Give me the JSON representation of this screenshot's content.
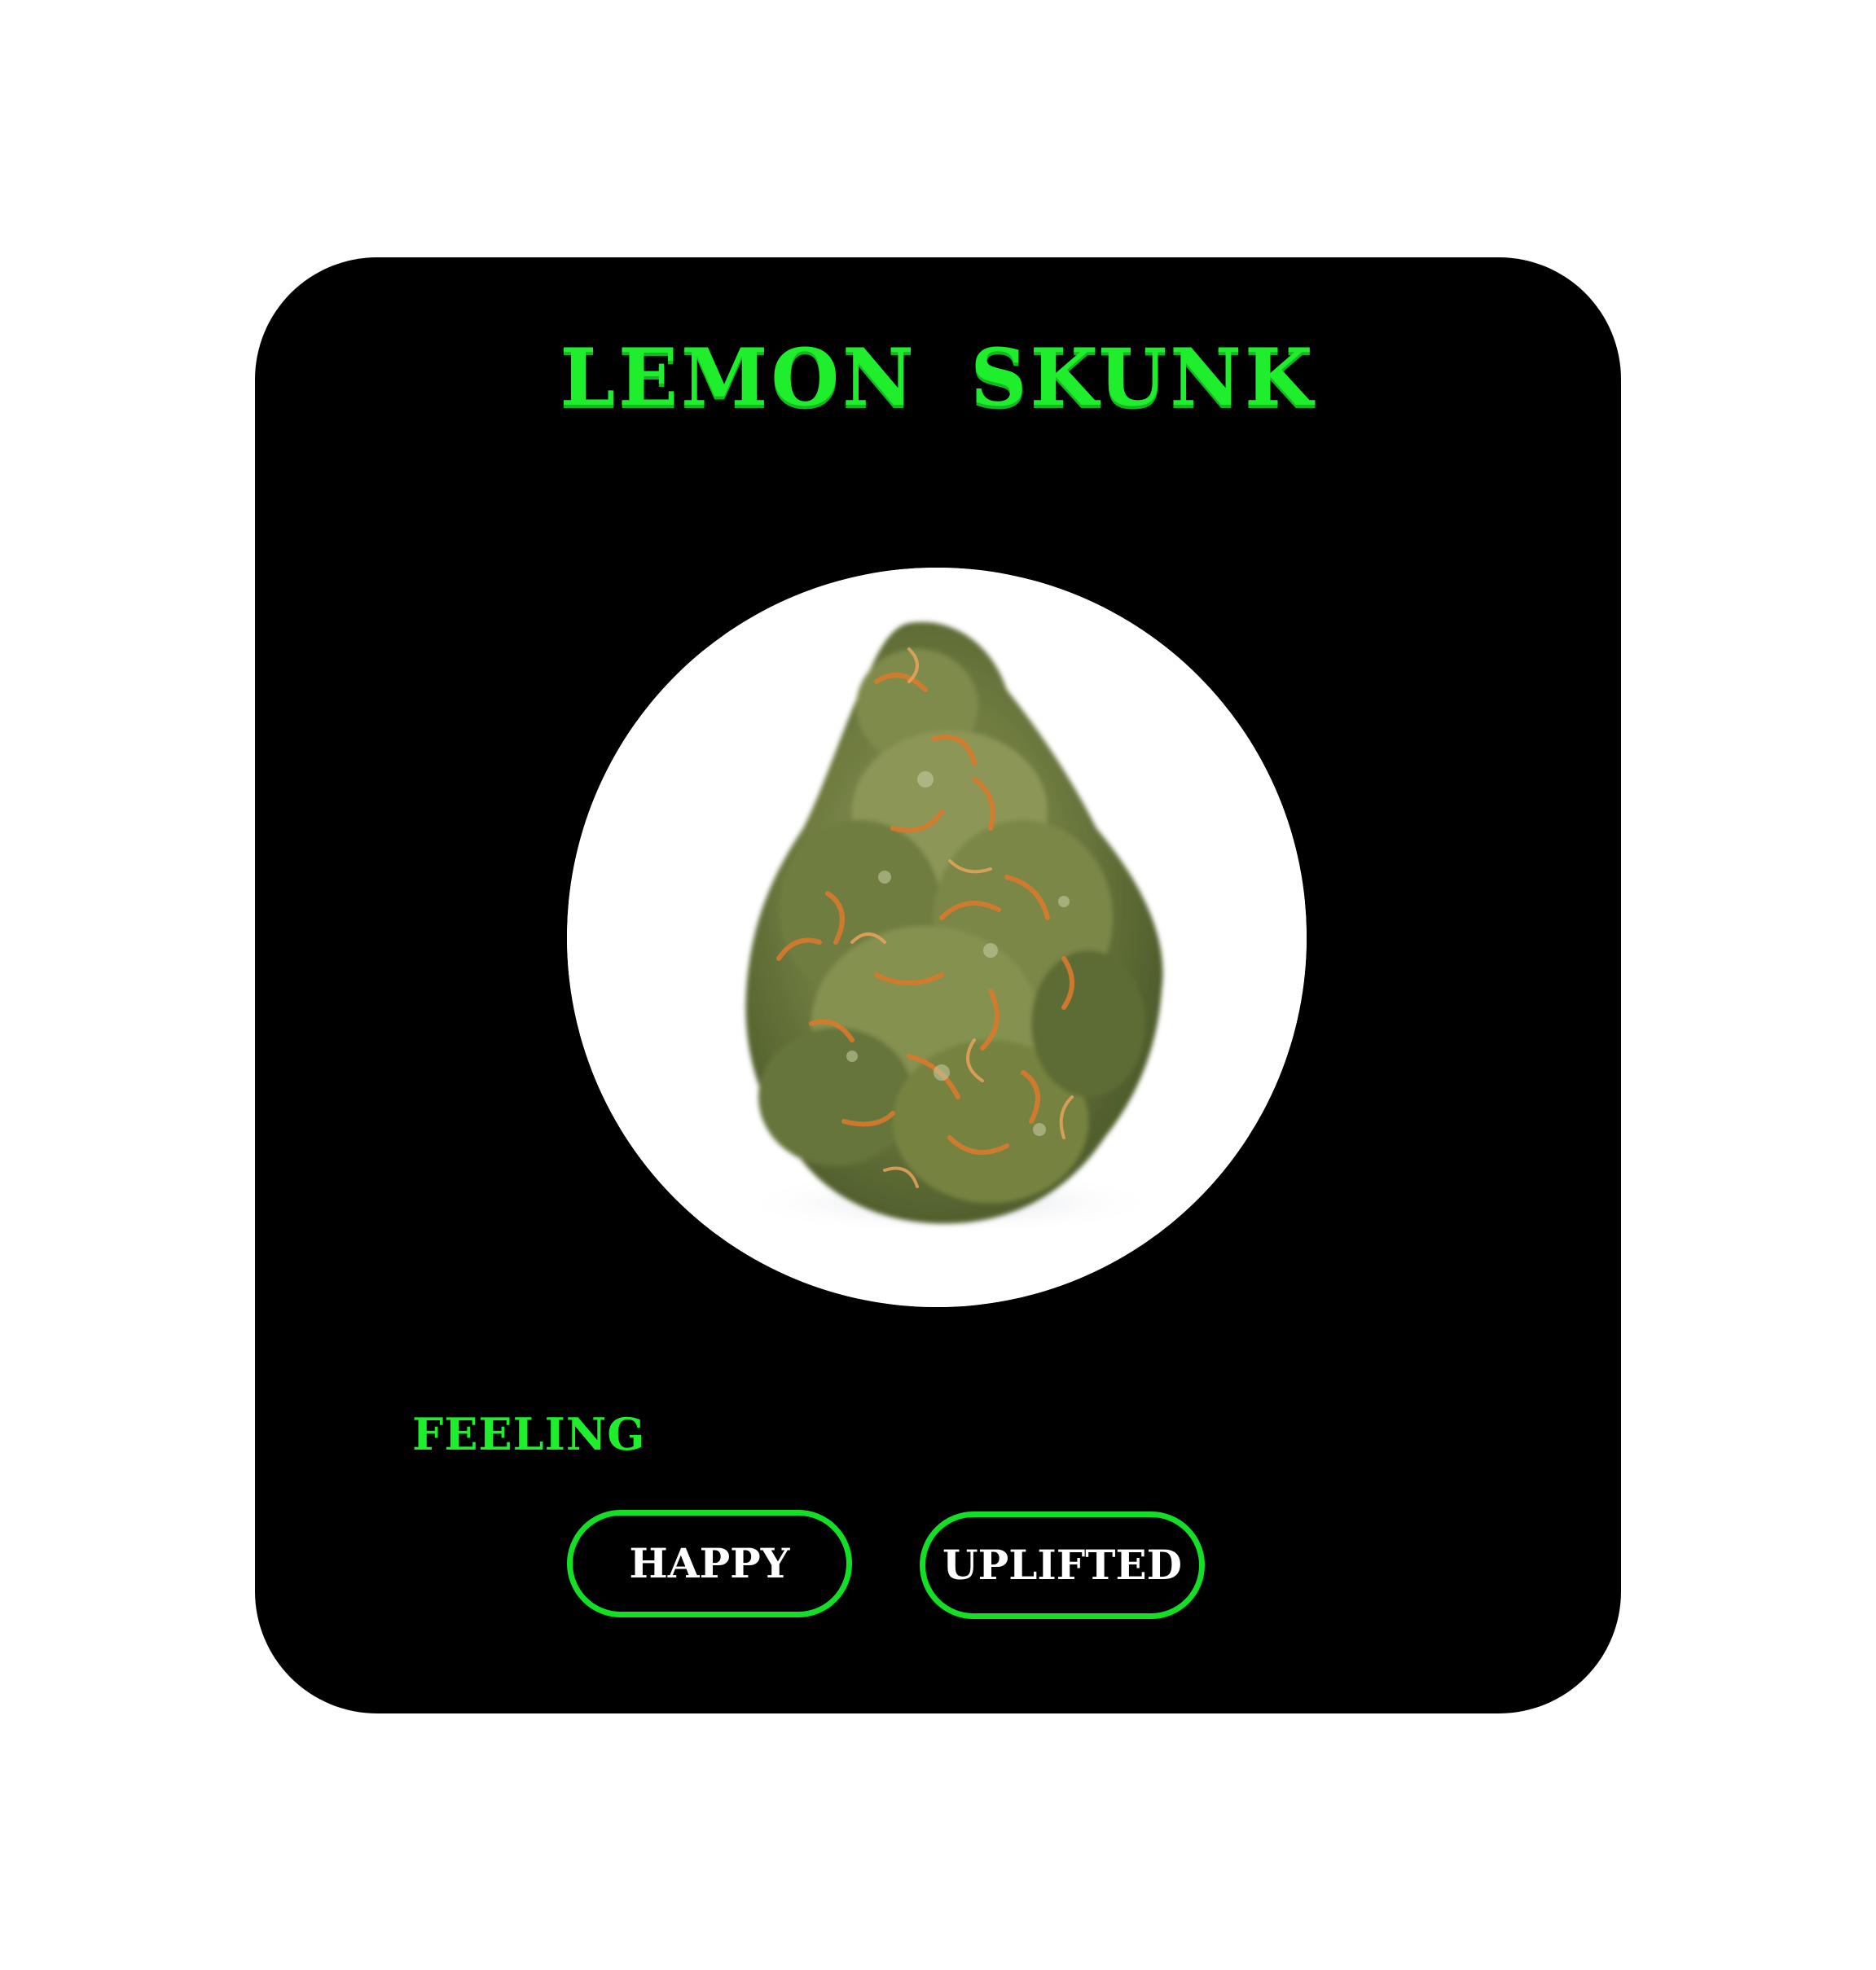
{
  "card": {
    "title": "LEMON SKUNK",
    "image_alt": "cannabis-bud-photo",
    "section_label": "FEELING",
    "tags": [
      {
        "label": "HAPPY"
      },
      {
        "label": "UPLIFTED"
      }
    ]
  },
  "colors": {
    "card_background": "#000000",
    "accent_green": "#1fee2c",
    "tag_border": "#13e025",
    "tag_text": "#ffffff",
    "page_background": "#ffffff"
  }
}
